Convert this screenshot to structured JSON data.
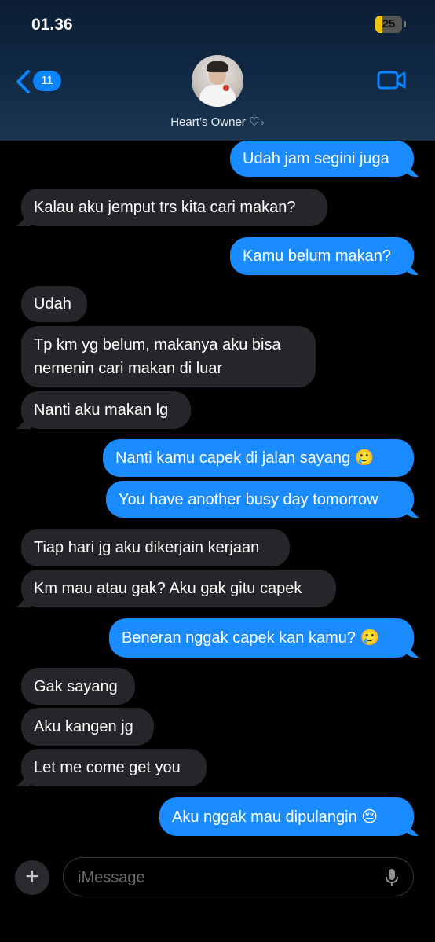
{
  "status_bar": {
    "time": "01.36",
    "battery": "25",
    "battery_level": 0.25
  },
  "header": {
    "back_count": "11",
    "contact_name": "Heart’s Owner ♡",
    "contact_chevron": "›"
  },
  "messages": [
    {
      "side": "out",
      "text": "Udah jam segini juga"
    },
    {
      "side": "in",
      "text": "Kalau aku jemput trs kita cari makan?"
    },
    {
      "side": "out",
      "text": "Kamu belum makan?"
    },
    {
      "side": "in",
      "text": "Udah"
    },
    {
      "side": "in",
      "text": "Tp km yg belum, makanya aku bisa nemenin cari makan di luar"
    },
    {
      "side": "in",
      "text": "Nanti aku makan lg"
    },
    {
      "side": "out",
      "text": "Nanti kamu capek di jalan sayang 🥲"
    },
    {
      "side": "out",
      "text": "You have another busy day tomorrow"
    },
    {
      "side": "in",
      "text": "Tiap hari jg aku dikerjain kerjaan"
    },
    {
      "side": "in",
      "text": "Km mau atau gak? Aku gak gitu capek"
    },
    {
      "side": "out",
      "text": "Beneran nggak capek kan kamu? 🥲"
    },
    {
      "side": "in",
      "text": "Gak sayang"
    },
    {
      "side": "in",
      "text": "Aku kangen jg"
    },
    {
      "side": "in",
      "text": "Let me come get you"
    },
    {
      "side": "out",
      "text": "Aku nggak mau dipulangin 😔"
    }
  ],
  "composer": {
    "plus": "+",
    "placeholder": "iMessage"
  },
  "icons": {
    "back": "chevron-left-icon",
    "video": "video-camera-icon",
    "mic": "microphone-icon",
    "add": "plus-icon"
  },
  "colors": {
    "outgoing": "#1a8cff",
    "incoming": "#26262a",
    "accent": "#0a84ff"
  }
}
